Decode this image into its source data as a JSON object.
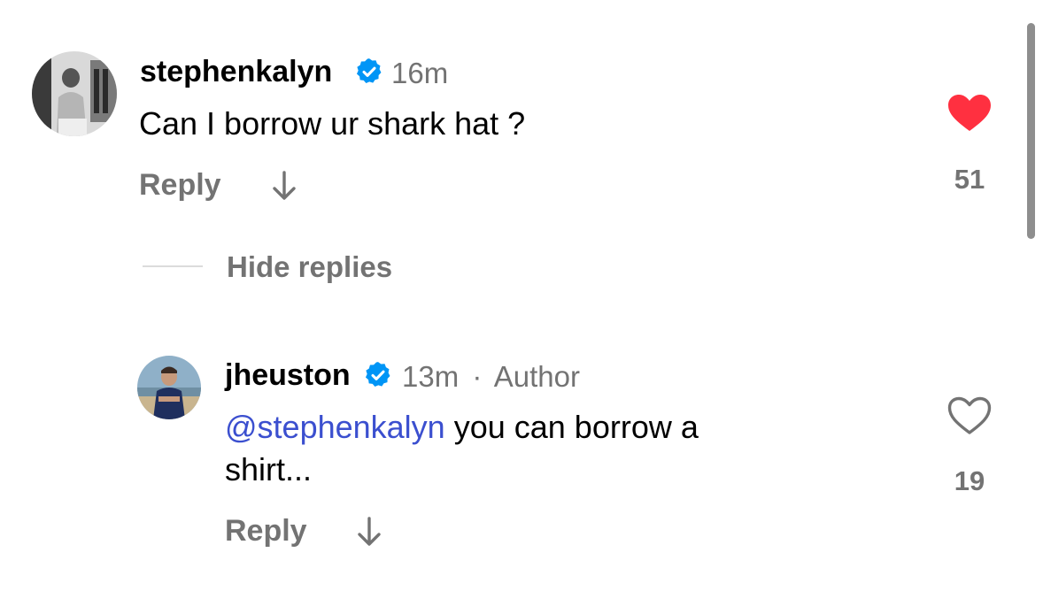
{
  "comments": [
    {
      "username": "stephenkalyn",
      "verified": true,
      "time": "16m",
      "text": "Can I borrow ur shark hat ?",
      "reply_label": "Reply",
      "like_count": "51",
      "liked": true,
      "avatar_icon": "user-avatar-photo"
    }
  ],
  "hide_replies_label": "Hide replies",
  "replies": [
    {
      "username": "jheuston",
      "verified": true,
      "time": "13m",
      "separator": "·",
      "author_label": "Author",
      "mention": "@stephenkalyn",
      "text_line1": " you can borrow a",
      "text_line2": "shirt...",
      "reply_label": "Reply",
      "like_count": "19",
      "liked": false,
      "avatar_icon": "user-avatar-photo"
    }
  ],
  "colors": {
    "like_red": "#ff3040",
    "verified_blue": "#0095f6",
    "mention_blue": "#3b4fcf",
    "secondary_gray": "#737373"
  }
}
